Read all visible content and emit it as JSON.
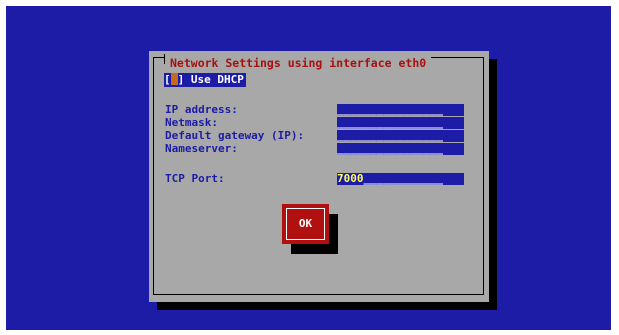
{
  "dialog": {
    "title": "Network Settings using interface eth0",
    "dhcp": {
      "box": "[ ]",
      "label": "Use DHCP",
      "checked": false
    },
    "fields": [
      {
        "key": "ip",
        "label": "IP address:",
        "value": "",
        "fill": "________________"
      },
      {
        "key": "netmask",
        "label": "Netmask:",
        "value": "",
        "fill": "________________"
      },
      {
        "key": "gateway",
        "label": "Default gateway (IP):",
        "value": "",
        "fill": "________________"
      },
      {
        "key": "nameserver",
        "label": "Nameserver:",
        "value": "",
        "fill": "________________"
      },
      {
        "key": "port",
        "label": "TCP Port:",
        "value": "7000",
        "fill": "____________"
      }
    ],
    "ok_label": "OK"
  },
  "colors": {
    "background": "#1c1ca6",
    "dialog": "#a8a8a8",
    "title": "#a81010",
    "button": "#b01010",
    "field_value": "#ffff54",
    "cursor": "#c46a1a"
  }
}
